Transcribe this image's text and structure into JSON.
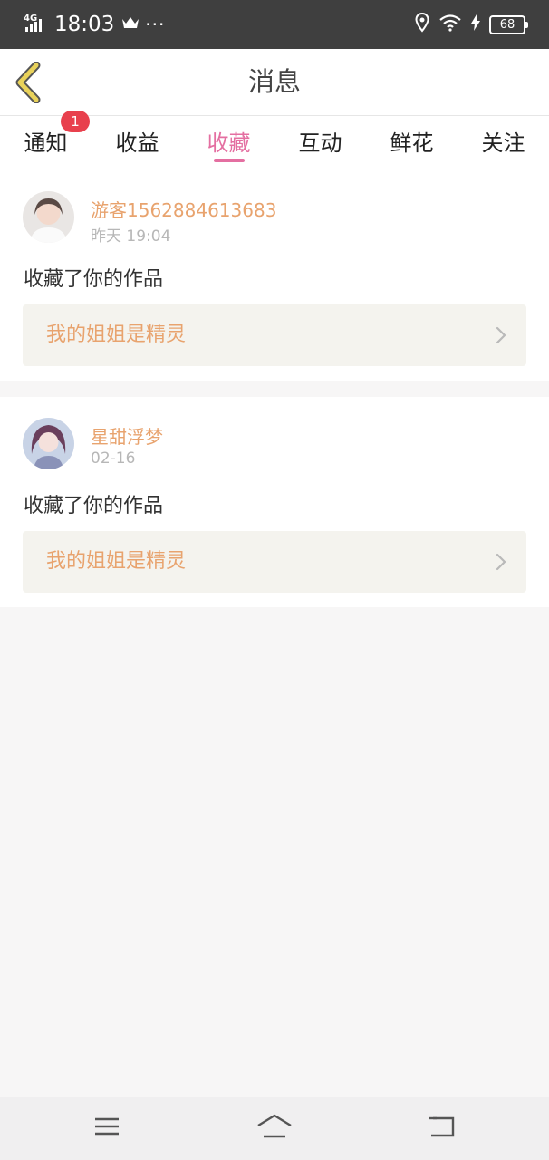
{
  "status_bar": {
    "network": "4G",
    "time": "18:03",
    "dots": "···",
    "battery": "68"
  },
  "header": {
    "title": "消息"
  },
  "tabs": [
    {
      "label": "通知",
      "badge": "1",
      "active": false
    },
    {
      "label": "收益",
      "active": false
    },
    {
      "label": "收藏",
      "active": true
    },
    {
      "label": "互动",
      "active": false
    },
    {
      "label": "鲜花",
      "active": false
    },
    {
      "label": "关注",
      "active": false
    }
  ],
  "messages": [
    {
      "username": "游客1562884613683",
      "time": "昨天 19:04",
      "action": "收藏了你的作品",
      "work_title": "我的姐姐是精灵"
    },
    {
      "username": "星甜浮梦",
      "time": "02-16",
      "action": "收藏了你的作品",
      "work_title": "我的姐姐是精灵"
    }
  ],
  "colors": {
    "accent": "#e46fa1",
    "username": "#e8a36e",
    "badge": "#e8404d",
    "back_arrow": "#e9d25a"
  }
}
